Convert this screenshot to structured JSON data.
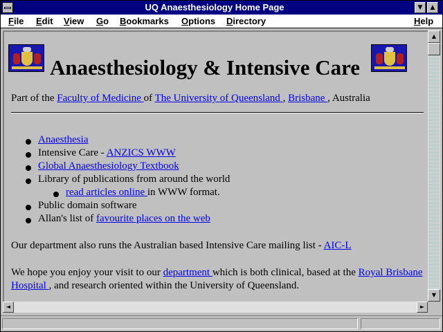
{
  "window": {
    "title": "UQ Anaesthesiology Home Page",
    "minimize_glyph": "▼",
    "maximize_glyph": "▲"
  },
  "menu": {
    "items": [
      {
        "label": "File",
        "accel": "F"
      },
      {
        "label": "Edit",
        "accel": "E"
      },
      {
        "label": "View",
        "accel": "V"
      },
      {
        "label": "Go",
        "accel": "G"
      },
      {
        "label": "Bookmarks",
        "accel": "B"
      },
      {
        "label": "Options",
        "accel": "O"
      },
      {
        "label": "Directory",
        "accel": "D"
      },
      {
        "label": "Help",
        "accel": "H"
      }
    ]
  },
  "page": {
    "heading": "Anaesthesiology & Intensive Care",
    "intro": {
      "prefix": "Part of the ",
      "link1": "Faculty of Medicine ",
      "sep1": " of ",
      "link2": "The University of Queensland ",
      "sep2": ", ",
      "link3": "Brisbane ",
      "suffix": ", Australia"
    },
    "list": [
      {
        "link": "Anaesthesia "
      },
      {
        "text": "Intensive Care - ",
        "link": "ANZICS WWW "
      },
      {
        "link": "Global Anaesthesiology Textbook "
      },
      {
        "text": "Library of publications from around the world"
      },
      {
        "link": "read articles online ",
        "suffix": " in WWW format."
      },
      {
        "text": "Public domain software"
      },
      {
        "text": "Allan's list of ",
        "link": "favourite places on the web "
      }
    ],
    "mailing": {
      "text": "Our department also runs the Australian based Intensive Care mailing list - ",
      "link": "AIC-L "
    },
    "closing": {
      "text1": "We hope you enjoy your visit to our ",
      "link1": "department ",
      "text2": " which is both clinical, based at the ",
      "link2a": "Royal Brisbane",
      "link2b": "Hospital ",
      "text3": ", and research oriented within the University of Queensland."
    }
  },
  "scrollbars": {
    "up": "▲",
    "down": "▼",
    "left": "◄",
    "right": "►"
  }
}
